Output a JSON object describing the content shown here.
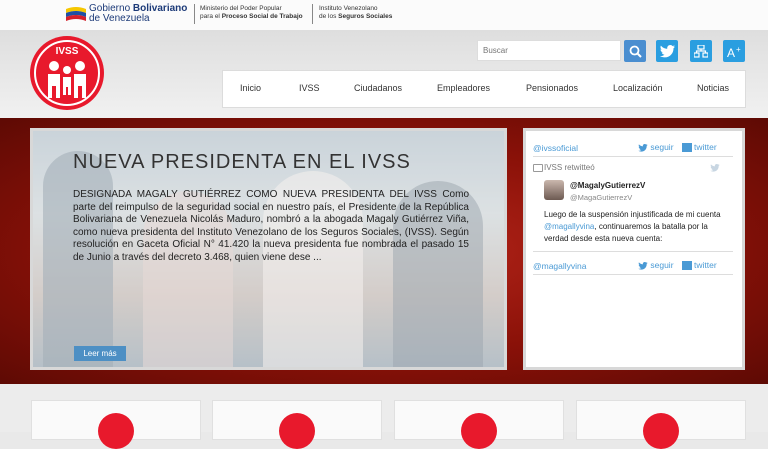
{
  "topbar": {
    "gov_line1_regular": "Gobierno ",
    "gov_line1_bold": "Bolivariano",
    "gov_line2": "de Venezuela",
    "ministry_line1": "Ministerio del Poder Popular",
    "ministry_line2_regular": "para el ",
    "ministry_line2_bold": "Proceso Social de Trabajo",
    "institute_line1": "Instituto Venezolano",
    "institute_line2_regular": "de los ",
    "institute_line2_bold": "Seguros Sociales"
  },
  "logo": {
    "text": "IVSS"
  },
  "search": {
    "placeholder": "Buscar"
  },
  "icons": [
    "search-icon",
    "twitter-icon",
    "sitemap-icon",
    "font-size-icon"
  ],
  "nav": {
    "items": [
      "Inicio",
      "IVSS",
      "Ciudadanos",
      "Empleadores",
      "Pensionados",
      "Localización",
      "Noticias"
    ]
  },
  "slide": {
    "title": "NUEVA PRESIDENTA EN EL IVSS",
    "text": "DESIGNADA MAGALY GUTIÉRREZ  COMO NUEVA PRESIDENTA DEL IVSS Como parte del reimpulso de la seguridad social en nuestro país, el Presidente de la República Bolivariana de Venezuela Nicolás Maduro, nombró a la abogada Magaly Gutiérrez Viña, como nueva presidenta del Instituto Venezolano de los Seguros Sociales, (IVSS). Según resolución en Gaceta Oficial N° 41.420 la nueva presidenta fue nombrada el pasado 15 de Junio a través del decreto 3.468, quien viene dese ...",
    "more_label": "Leer más"
  },
  "twitter": {
    "account1": "@ivssoficial",
    "account2": "@magallyvina",
    "follow_label": "seguir",
    "brand_label": "twitter",
    "retweet_label": "IVSS retwitteó",
    "tweet_name": "@MagalyGutierrezV",
    "tweet_handle": "@MagaGutierrezV",
    "tweet_text_1": "Luego de la suspensión injustificada de mi cuenta ",
    "tweet_mention": "@magallyvina",
    "tweet_text_2": ", continuaremos la batalla por la verdad desde esta nueva cuenta:"
  },
  "colors": {
    "brand_red": "#e8192c",
    "twitter_blue": "#4a9ad5",
    "banner_red": "#8a1108"
  }
}
